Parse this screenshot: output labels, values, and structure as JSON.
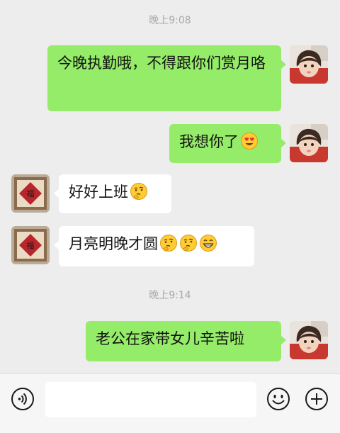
{
  "chat": {
    "timestamps": [
      "晚上9:08",
      "晚上9:14"
    ],
    "messages": [
      {
        "sender": "me",
        "text": "今晚执勤哦，不得跟你们赏月咯",
        "emojis": []
      },
      {
        "sender": "me",
        "text": "我想你了",
        "emojis": [
          "heart-eyes-emoji"
        ]
      },
      {
        "sender": "them",
        "text": "好好上班",
        "emojis": [
          "thinking-emoji"
        ]
      },
      {
        "sender": "them",
        "text": "月亮明晚才圆",
        "emojis": [
          "thinking-emoji",
          "thinking-emoji",
          "grinning-emoji"
        ]
      },
      {
        "sender": "me",
        "text": "老公在家带女儿辛苦啦",
        "emojis": []
      }
    ]
  },
  "input_bar": {
    "voice_icon": "voice-icon",
    "text_value": "",
    "emoji_icon": "emoji-icon",
    "plus_icon": "plus-icon"
  },
  "colors": {
    "background": "#ededed",
    "my_bubble": "#95ec69",
    "their_bubble": "#ffffff",
    "timestamp": "#a8a8a8"
  }
}
